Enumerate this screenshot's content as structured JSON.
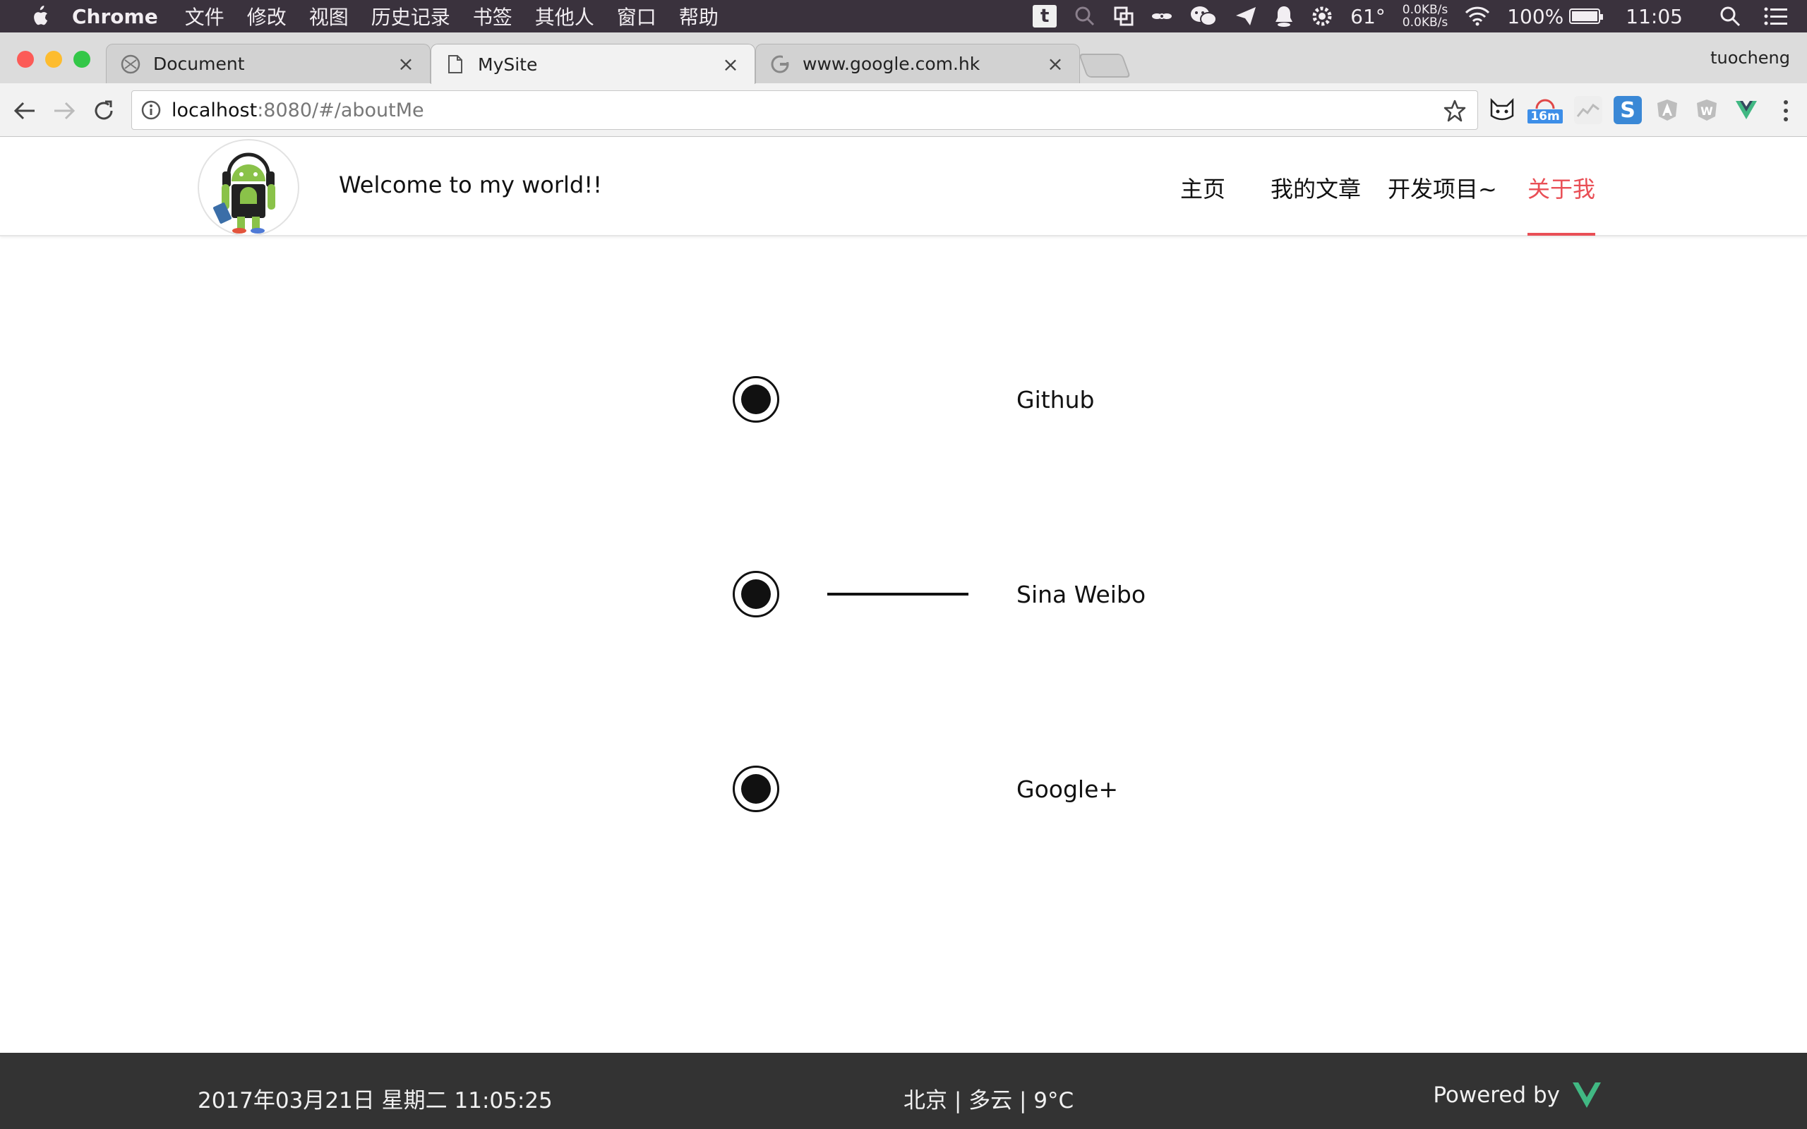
{
  "menubar": {
    "app_name": "Chrome",
    "items": [
      "文件",
      "修改",
      "视图",
      "历史记录",
      "书签",
      "其他人",
      "窗口",
      "帮助"
    ],
    "status": {
      "temperature": "61°",
      "net_up": "0.0KB/s",
      "net_down": "0.0KB/s",
      "battery": "100%",
      "battery_level": 1.0,
      "time": "11:05"
    }
  },
  "browser": {
    "profile_name": "tuocheng",
    "tabs": [
      {
        "title": "Document",
        "close": "×",
        "icon": "globe-icon"
      },
      {
        "title": "MySite",
        "close": "×",
        "icon": "page-icon"
      },
      {
        "title": "www.google.com.hk",
        "close": "×",
        "icon": "google-icon"
      }
    ],
    "url_host": "localhost",
    "url_rest": ":8080/#/aboutMe",
    "extensions": [
      {
        "name": "cat-extension-icon"
      },
      {
        "name": "timer-extension-icon",
        "badge": "16m"
      },
      {
        "name": "chart-extension-icon"
      },
      {
        "name": "s-extension-icon"
      },
      {
        "name": "angular-extension-icon"
      },
      {
        "name": "w-extension-icon"
      },
      {
        "name": "vue-extension-icon"
      }
    ]
  },
  "site": {
    "welcome": "Welcome to my world!!",
    "nav": [
      "主页",
      "我的文章",
      "开发项目~",
      "关于我"
    ],
    "active_nav": "关于我",
    "accent_color": "#e94f56",
    "links": [
      {
        "label": "Github"
      },
      {
        "label": "Sina Weibo"
      },
      {
        "label": "Google+"
      }
    ]
  },
  "footer": {
    "datetime": "2017年03月21日 星期二 11:05:25",
    "weather": "北京 | 多云 | 9°C",
    "powered_by": "Powered by"
  }
}
